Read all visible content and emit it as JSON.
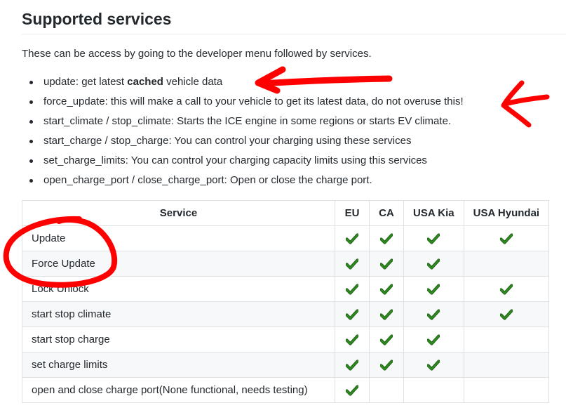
{
  "heading": "Supported services",
  "intro": "These can be access by going to the developer menu followed by services.",
  "bullets": [
    {
      "pre": "update: get latest ",
      "bold": "cached",
      "post": " vehicle data"
    },
    {
      "pre": "force_update: this will make a call to your vehicle to get its latest data, do not overuse this!",
      "bold": "",
      "post": ""
    },
    {
      "pre": "start_climate / stop_climate: Starts the ICE engine in some regions or starts EV climate.",
      "bold": "",
      "post": ""
    },
    {
      "pre": "start_charge / stop_charge: You can control your charging using these services",
      "bold": "",
      "post": ""
    },
    {
      "pre": "set_charge_limits: You can control your charging capacity limits using this services",
      "bold": "",
      "post": ""
    },
    {
      "pre": "open_charge_port / close_charge_port: Open or close the charge port.",
      "bold": "",
      "post": ""
    }
  ],
  "table": {
    "headers": [
      "Service",
      "EU",
      "CA",
      "USA Kia",
      "USA Hyundai"
    ],
    "rows": [
      {
        "service": "Update",
        "support": [
          true,
          true,
          true,
          true
        ]
      },
      {
        "service": "Force Update",
        "support": [
          true,
          true,
          true,
          false
        ]
      },
      {
        "service": "Lock Unlock",
        "support": [
          true,
          true,
          true,
          true
        ]
      },
      {
        "service": "start stop climate",
        "support": [
          true,
          true,
          true,
          true
        ]
      },
      {
        "service": "start stop charge",
        "support": [
          true,
          true,
          true,
          false
        ]
      },
      {
        "service": "set charge limits",
        "support": [
          true,
          true,
          true,
          false
        ]
      },
      {
        "service": "open and close charge port(None functional, needs testing)",
        "support": [
          true,
          false,
          false,
          false
        ]
      }
    ]
  },
  "icons": {
    "check": "check-mark-icon"
  },
  "colors": {
    "text": "#24292e",
    "check": "#2e8b1f",
    "check_outline": "#1e5e14",
    "annotation": "#ff0000",
    "border": "#dfe2e5",
    "stripe": "#f6f8fa"
  }
}
